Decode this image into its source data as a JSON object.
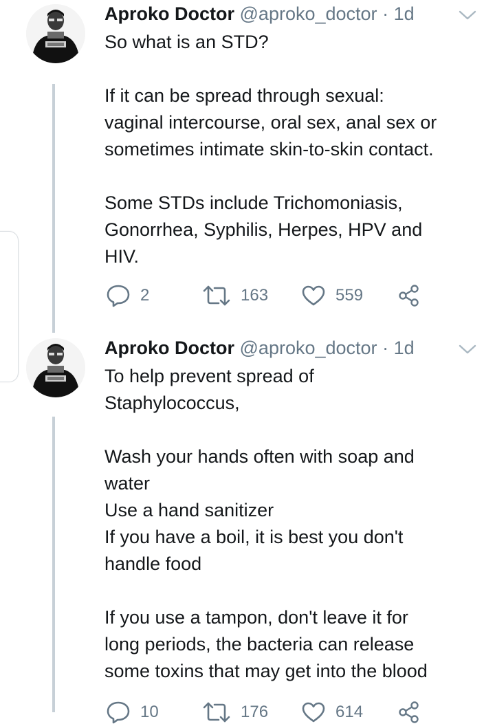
{
  "tweets": [
    {
      "author": "Aproko Doctor",
      "handle": "@aproko_doctor",
      "separator": "·",
      "time": "1d",
      "lines": [
        "So what is an STD?",
        "",
        "If it can be spread through sexual:",
        "vaginal intercourse, oral sex, anal sex or",
        "sometimes intimate skin-to-skin contact.",
        "",
        "Some STDs include Trichomoniasis,",
        "Gonorrhea, Syphilis, Herpes, HPV and",
        "HIV."
      ],
      "replies": "2",
      "retweets": "163",
      "likes": "559"
    },
    {
      "author": "Aproko Doctor",
      "handle": "@aproko_doctor",
      "separator": "·",
      "time": "1d",
      "lines": [
        "To help prevent spread of",
        "Staphylococcus,",
        "",
        "Wash your hands often with soap and",
        "water",
        "Use a hand sanitizer",
        "If you have a boil, it is best you don't",
        "handle food",
        "",
        "If you use a tampon, don't leave it for",
        "long periods, the bacteria can release",
        "some toxins that may get into the blood"
      ],
      "replies": "10",
      "retweets": "176",
      "likes": "614"
    }
  ],
  "icons": {
    "reply": "reply-icon",
    "retweet": "retweet-icon",
    "like": "heart-icon",
    "share": "share-icon",
    "menu": "chevron-down-icon",
    "avatar": "avatar"
  },
  "colors": {
    "text": "#14171a",
    "muted": "#657786",
    "thread_line": "#c7d0d7"
  }
}
